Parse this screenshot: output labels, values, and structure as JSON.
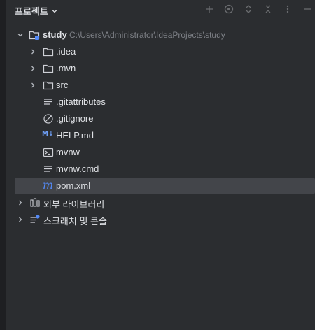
{
  "header": {
    "title": "프로젝트"
  },
  "tree": {
    "root": {
      "label": "study",
      "path": "C:\\Users\\Administrator\\IdeaProjects\\study"
    },
    "folders": [
      {
        "label": ".idea"
      },
      {
        "label": ".mvn"
      },
      {
        "label": "src"
      }
    ],
    "files": [
      {
        "label": ".gitattributes",
        "icon": "text-file-icon"
      },
      {
        "label": ".gitignore",
        "icon": "gitignore-icon"
      },
      {
        "label": "HELP.md",
        "icon": "markdown-icon",
        "icon_text": "M↓"
      },
      {
        "label": "mvnw",
        "icon": "shell-script-icon"
      },
      {
        "label": "mvnw.cmd",
        "icon": "text-file-icon"
      },
      {
        "label": "pom.xml",
        "icon": "maven-icon",
        "icon_text": "m"
      }
    ],
    "external_libraries": {
      "label": "외부 라이브러리"
    },
    "scratches": {
      "label": "스크래치 및 콘솔"
    }
  },
  "colors": {
    "background": "#2b2d30",
    "selected": "#43454a",
    "accent": "#548af7",
    "muted": "#7e8187",
    "text": "#dfe1e5"
  }
}
